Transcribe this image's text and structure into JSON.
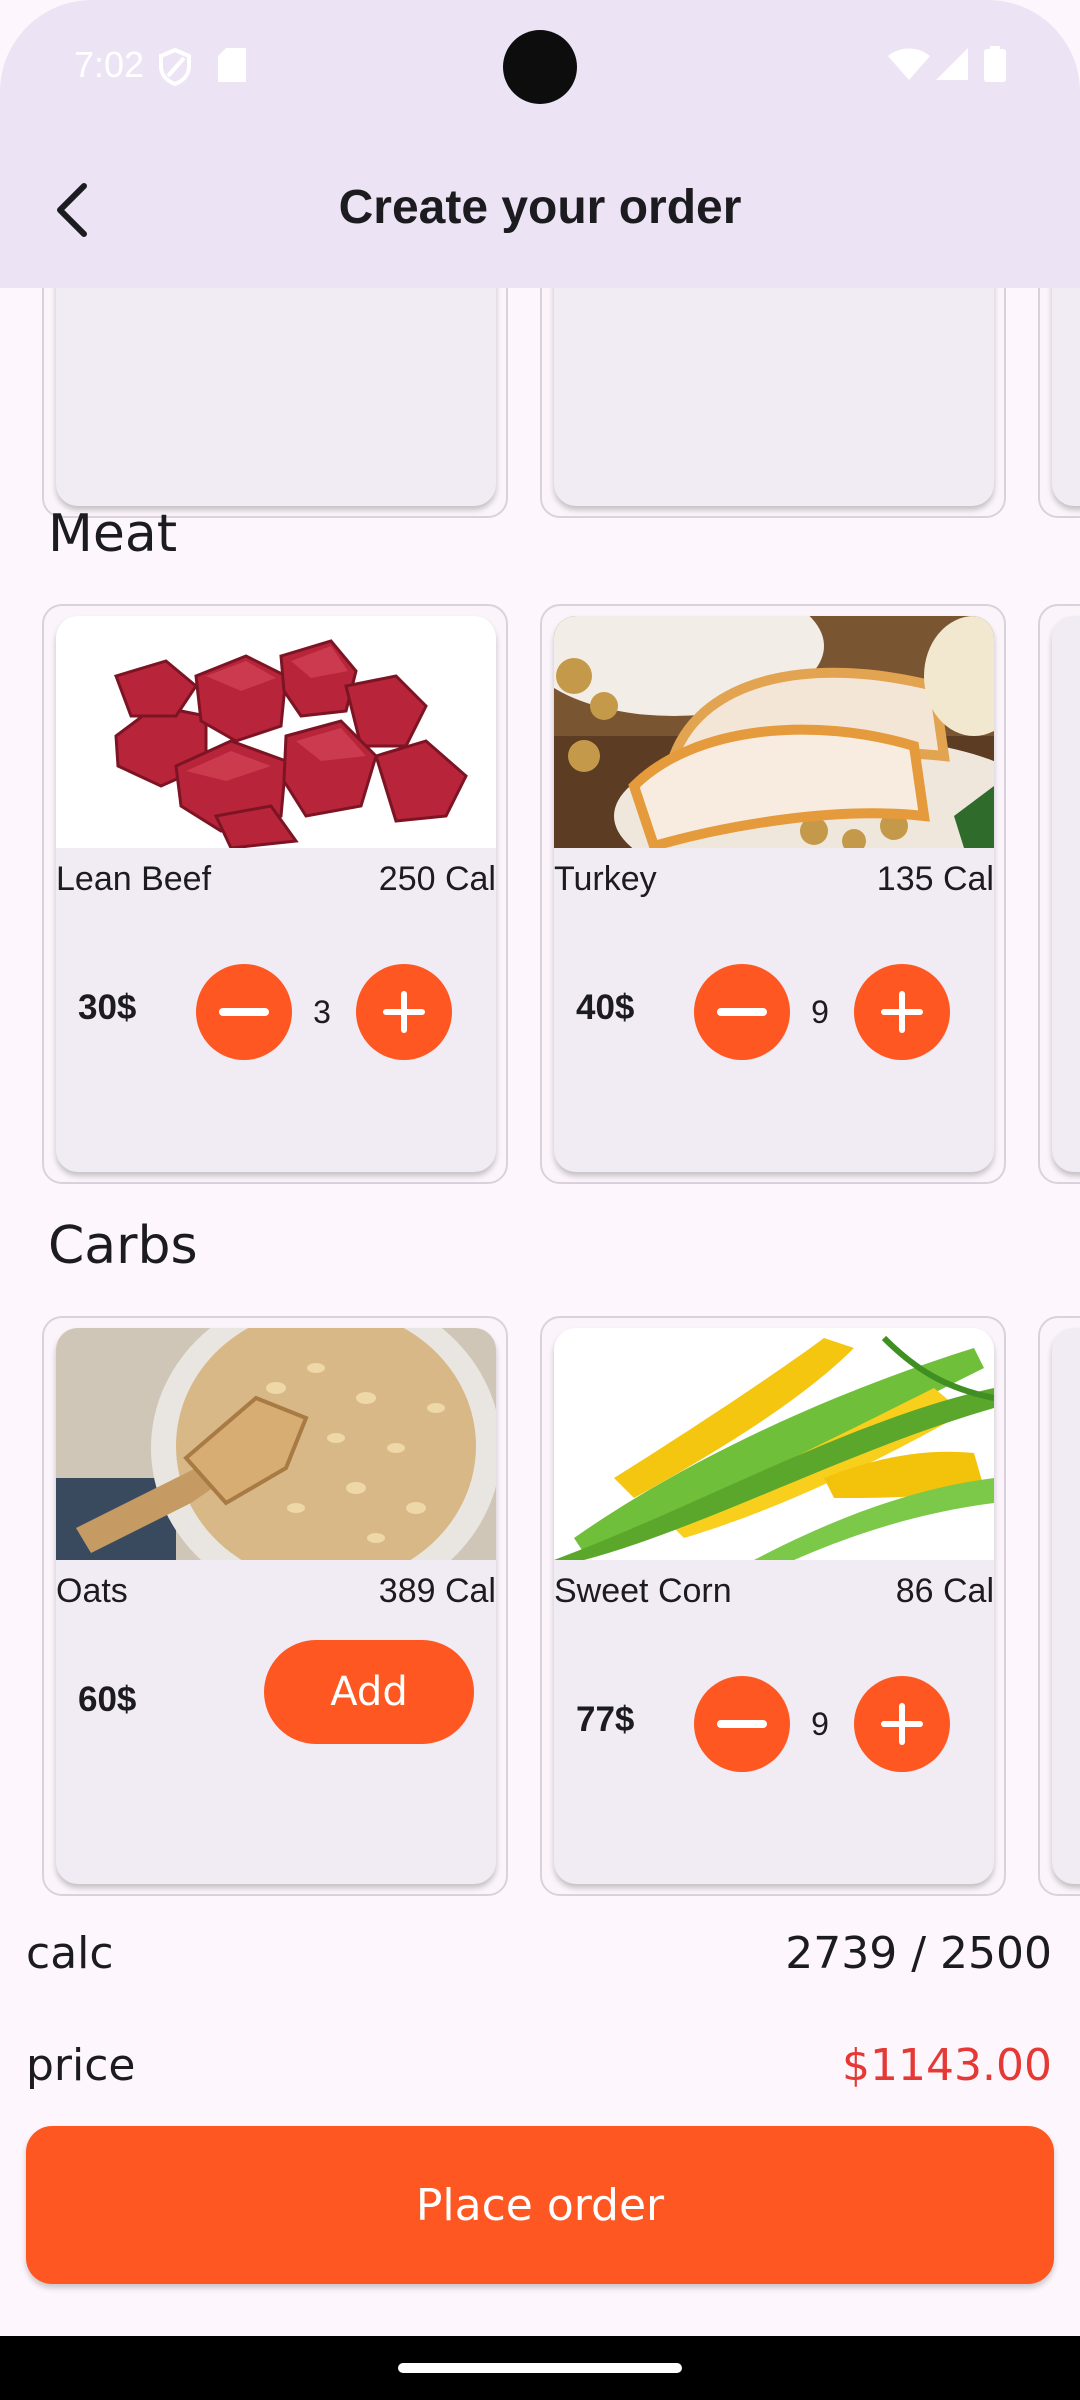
{
  "status_bar": {
    "time": "7:02"
  },
  "app_bar": {
    "title": "Create your order"
  },
  "sections": [
    {
      "title": "Meat"
    },
    {
      "title": "Carbs"
    }
  ],
  "meat": [
    {
      "name": "Lean Beef",
      "cal": "250 Cal",
      "price": "30$",
      "qty": "3"
    },
    {
      "name": "Turkey",
      "cal": "135 Cal",
      "price": "40$",
      "qty": "9"
    }
  ],
  "carbs": [
    {
      "name": "Oats",
      "cal": "389 Cal",
      "price": "60$",
      "add_label": "Add"
    },
    {
      "name": "Sweet Corn",
      "cal": "86 Cal",
      "price": "77$",
      "qty": "9"
    }
  ],
  "totals": {
    "calc_label": "calc",
    "calc_value": "2739 / 2500",
    "price_label": "price",
    "price_value": "$1143.00"
  },
  "place_order_label": "Place order",
  "colors": {
    "accent": "#fe5722",
    "price": "#e53935",
    "appbar": "#ece3f4"
  }
}
